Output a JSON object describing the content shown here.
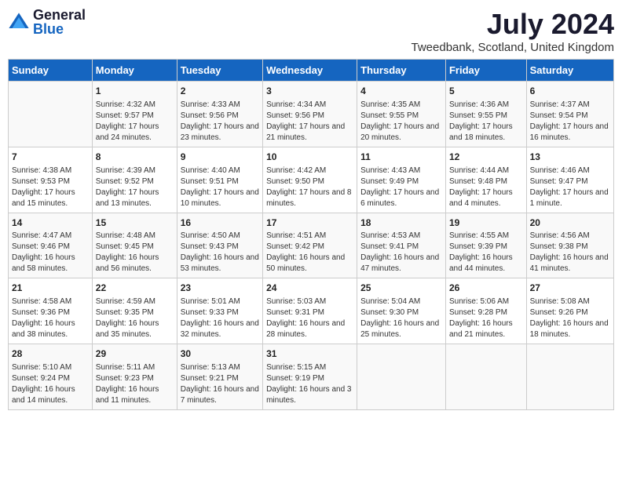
{
  "header": {
    "logo_general": "General",
    "logo_blue": "Blue",
    "month_title": "July 2024",
    "location": "Tweedbank, Scotland, United Kingdom"
  },
  "columns": [
    "Sunday",
    "Monday",
    "Tuesday",
    "Wednesday",
    "Thursday",
    "Friday",
    "Saturday"
  ],
  "weeks": [
    [
      {
        "day": "",
        "info": ""
      },
      {
        "day": "1",
        "info": "Sunrise: 4:32 AM\nSunset: 9:57 PM\nDaylight: 17 hours and 24 minutes."
      },
      {
        "day": "2",
        "info": "Sunrise: 4:33 AM\nSunset: 9:56 PM\nDaylight: 17 hours and 23 minutes."
      },
      {
        "day": "3",
        "info": "Sunrise: 4:34 AM\nSunset: 9:56 PM\nDaylight: 17 hours and 21 minutes."
      },
      {
        "day": "4",
        "info": "Sunrise: 4:35 AM\nSunset: 9:55 PM\nDaylight: 17 hours and 20 minutes."
      },
      {
        "day": "5",
        "info": "Sunrise: 4:36 AM\nSunset: 9:55 PM\nDaylight: 17 hours and 18 minutes."
      },
      {
        "day": "6",
        "info": "Sunrise: 4:37 AM\nSunset: 9:54 PM\nDaylight: 17 hours and 16 minutes."
      }
    ],
    [
      {
        "day": "7",
        "info": "Sunrise: 4:38 AM\nSunset: 9:53 PM\nDaylight: 17 hours and 15 minutes."
      },
      {
        "day": "8",
        "info": "Sunrise: 4:39 AM\nSunset: 9:52 PM\nDaylight: 17 hours and 13 minutes."
      },
      {
        "day": "9",
        "info": "Sunrise: 4:40 AM\nSunset: 9:51 PM\nDaylight: 17 hours and 10 minutes."
      },
      {
        "day": "10",
        "info": "Sunrise: 4:42 AM\nSunset: 9:50 PM\nDaylight: 17 hours and 8 minutes."
      },
      {
        "day": "11",
        "info": "Sunrise: 4:43 AM\nSunset: 9:49 PM\nDaylight: 17 hours and 6 minutes."
      },
      {
        "day": "12",
        "info": "Sunrise: 4:44 AM\nSunset: 9:48 PM\nDaylight: 17 hours and 4 minutes."
      },
      {
        "day": "13",
        "info": "Sunrise: 4:46 AM\nSunset: 9:47 PM\nDaylight: 17 hours and 1 minute."
      }
    ],
    [
      {
        "day": "14",
        "info": "Sunrise: 4:47 AM\nSunset: 9:46 PM\nDaylight: 16 hours and 58 minutes."
      },
      {
        "day": "15",
        "info": "Sunrise: 4:48 AM\nSunset: 9:45 PM\nDaylight: 16 hours and 56 minutes."
      },
      {
        "day": "16",
        "info": "Sunrise: 4:50 AM\nSunset: 9:43 PM\nDaylight: 16 hours and 53 minutes."
      },
      {
        "day": "17",
        "info": "Sunrise: 4:51 AM\nSunset: 9:42 PM\nDaylight: 16 hours and 50 minutes."
      },
      {
        "day": "18",
        "info": "Sunrise: 4:53 AM\nSunset: 9:41 PM\nDaylight: 16 hours and 47 minutes."
      },
      {
        "day": "19",
        "info": "Sunrise: 4:55 AM\nSunset: 9:39 PM\nDaylight: 16 hours and 44 minutes."
      },
      {
        "day": "20",
        "info": "Sunrise: 4:56 AM\nSunset: 9:38 PM\nDaylight: 16 hours and 41 minutes."
      }
    ],
    [
      {
        "day": "21",
        "info": "Sunrise: 4:58 AM\nSunset: 9:36 PM\nDaylight: 16 hours and 38 minutes."
      },
      {
        "day": "22",
        "info": "Sunrise: 4:59 AM\nSunset: 9:35 PM\nDaylight: 16 hours and 35 minutes."
      },
      {
        "day": "23",
        "info": "Sunrise: 5:01 AM\nSunset: 9:33 PM\nDaylight: 16 hours and 32 minutes."
      },
      {
        "day": "24",
        "info": "Sunrise: 5:03 AM\nSunset: 9:31 PM\nDaylight: 16 hours and 28 minutes."
      },
      {
        "day": "25",
        "info": "Sunrise: 5:04 AM\nSunset: 9:30 PM\nDaylight: 16 hours and 25 minutes."
      },
      {
        "day": "26",
        "info": "Sunrise: 5:06 AM\nSunset: 9:28 PM\nDaylight: 16 hours and 21 minutes."
      },
      {
        "day": "27",
        "info": "Sunrise: 5:08 AM\nSunset: 9:26 PM\nDaylight: 16 hours and 18 minutes."
      }
    ],
    [
      {
        "day": "28",
        "info": "Sunrise: 5:10 AM\nSunset: 9:24 PM\nDaylight: 16 hours and 14 minutes."
      },
      {
        "day": "29",
        "info": "Sunrise: 5:11 AM\nSunset: 9:23 PM\nDaylight: 16 hours and 11 minutes."
      },
      {
        "day": "30",
        "info": "Sunrise: 5:13 AM\nSunset: 9:21 PM\nDaylight: 16 hours and 7 minutes."
      },
      {
        "day": "31",
        "info": "Sunrise: 5:15 AM\nSunset: 9:19 PM\nDaylight: 16 hours and 3 minutes."
      },
      {
        "day": "",
        "info": ""
      },
      {
        "day": "",
        "info": ""
      },
      {
        "day": "",
        "info": ""
      }
    ]
  ]
}
